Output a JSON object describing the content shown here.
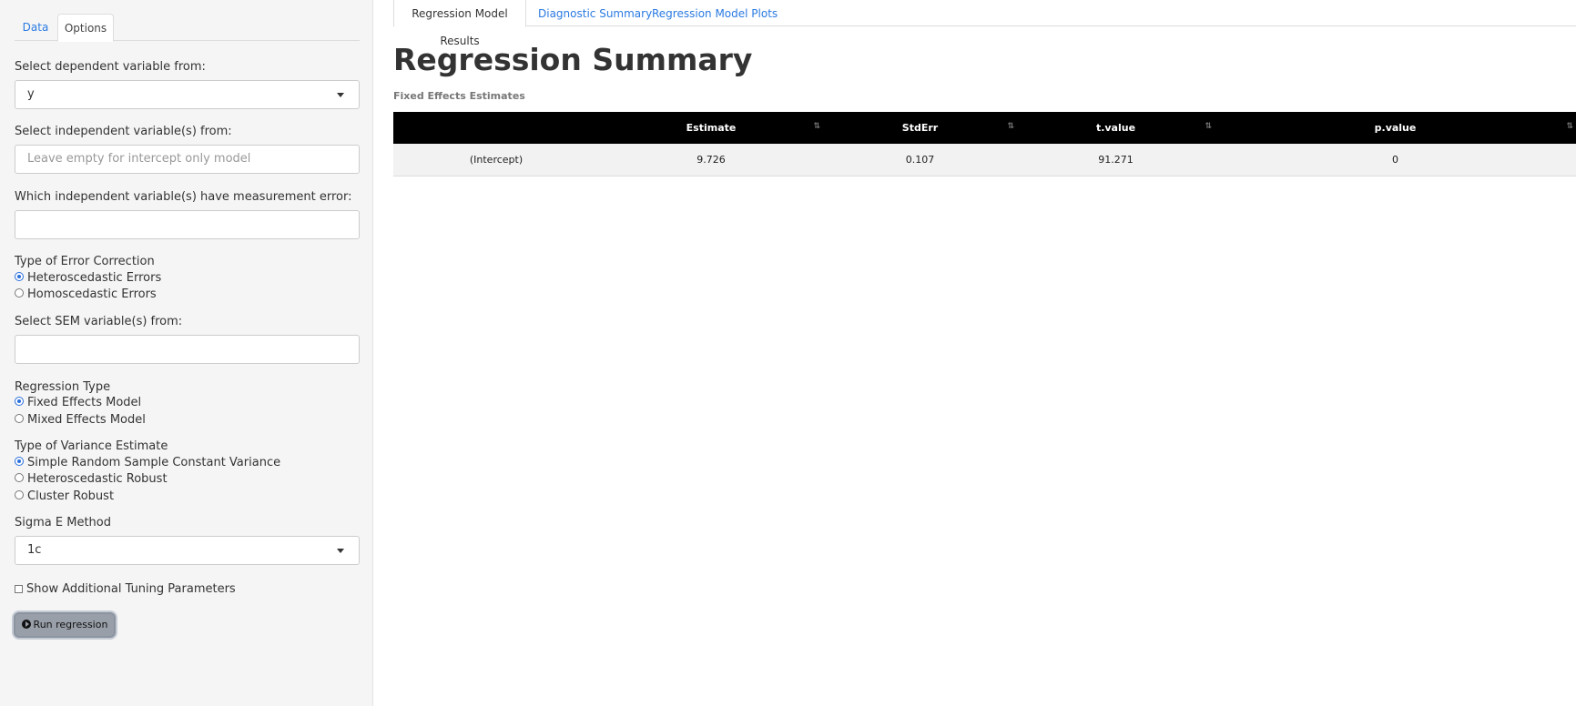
{
  "sidebar": {
    "tabs": [
      "Data",
      "Options"
    ],
    "dependent_label": "Select dependent variable from:",
    "dependent_value": "y",
    "independent_label": "Select independent variable(s) from:",
    "independent_placeholder": "Leave empty for intercept only model",
    "measurement_label": "Which independent variable(s) have measurement error:",
    "error_correction": {
      "label": "Type of Error Correction",
      "options": [
        "Heteroscedastic Errors",
        "Homoscedastic Errors"
      ],
      "selected": 0
    },
    "sem_label": "Select SEM variable(s) from:",
    "regression_type": {
      "label": "Regression Type",
      "options": [
        "Fixed Effects Model",
        "Mixed Effects Model"
      ],
      "selected": 0
    },
    "variance_estimate": {
      "label": "Type of Variance Estimate",
      "options": [
        "Simple Random Sample Constant Variance",
        "Heteroscedastic Robust",
        "Cluster Robust"
      ],
      "selected": 0
    },
    "sigma_label": "Sigma E Method",
    "sigma_value": "1c",
    "tuning_label": "Show Additional Tuning Parameters",
    "tuning_checked": false,
    "run_label": "Run regression"
  },
  "main": {
    "tabs": [
      "Regression Model Results",
      "Diagnostic Summary",
      "Regression Model Plots"
    ],
    "active_tab": 0,
    "title": "Regression Summary",
    "subtitle": "Fixed Effects Estimates",
    "table": {
      "columns": [
        "",
        "Estimate",
        "StdErr",
        "t.value",
        "p.value"
      ],
      "rows": [
        [
          "(Intercept)",
          "9.726",
          "0.107",
          "91.271",
          "0"
        ]
      ]
    },
    "sort_icon": "⇅"
  },
  "colors": {
    "link": "#2a7ae2",
    "sidebar_bg": "#f5f5f5",
    "table_header_bg": "#000000",
    "radio_selected": "#2a6fdb",
    "button_bg": "#999fa8"
  }
}
